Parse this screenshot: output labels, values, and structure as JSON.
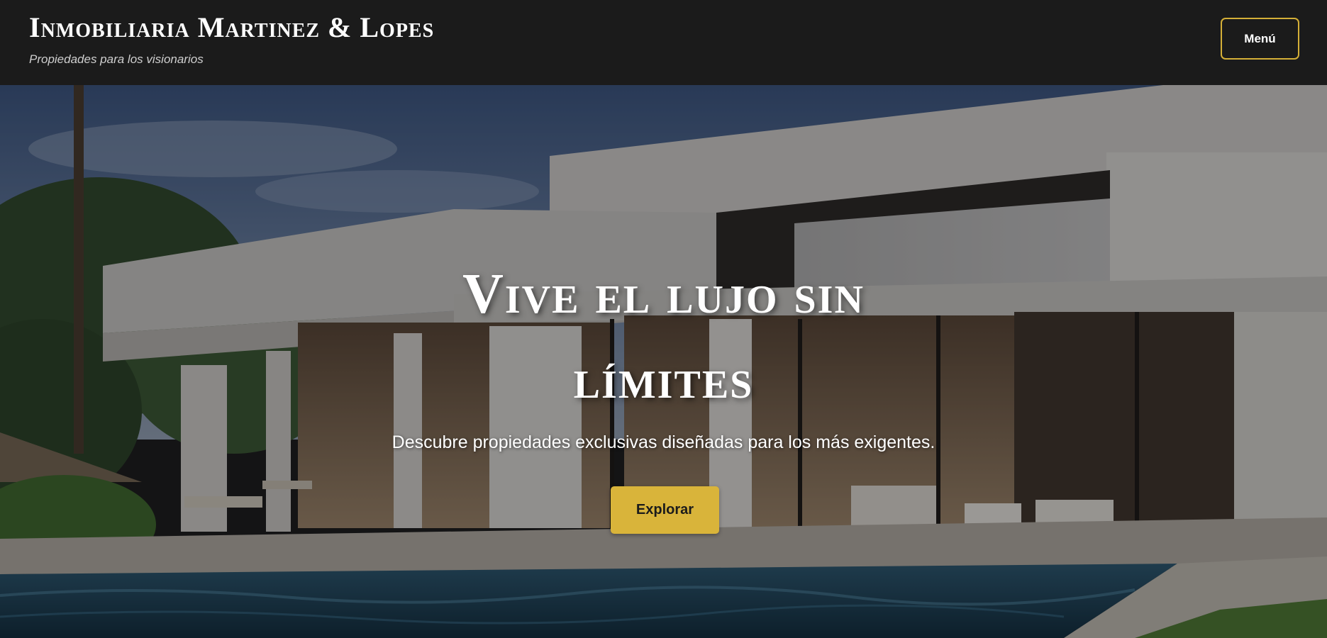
{
  "header": {
    "brand_title": "Inmobiliaria Martinez & Lopes",
    "tagline": "Propiedades para los visionarios",
    "menu_label": "Menú"
  },
  "hero": {
    "title": "Vive el lujo sin límites",
    "subtitle": "Descubre propiedades exclusivas diseñadas para los más exigentes.",
    "cta_label": "Explorar",
    "background_image": "modern-luxury-villa-with-pool"
  },
  "colors": {
    "header_bg": "#1b1b1b",
    "accent_gold": "#d9b43a",
    "text_light": "#ffffff"
  }
}
